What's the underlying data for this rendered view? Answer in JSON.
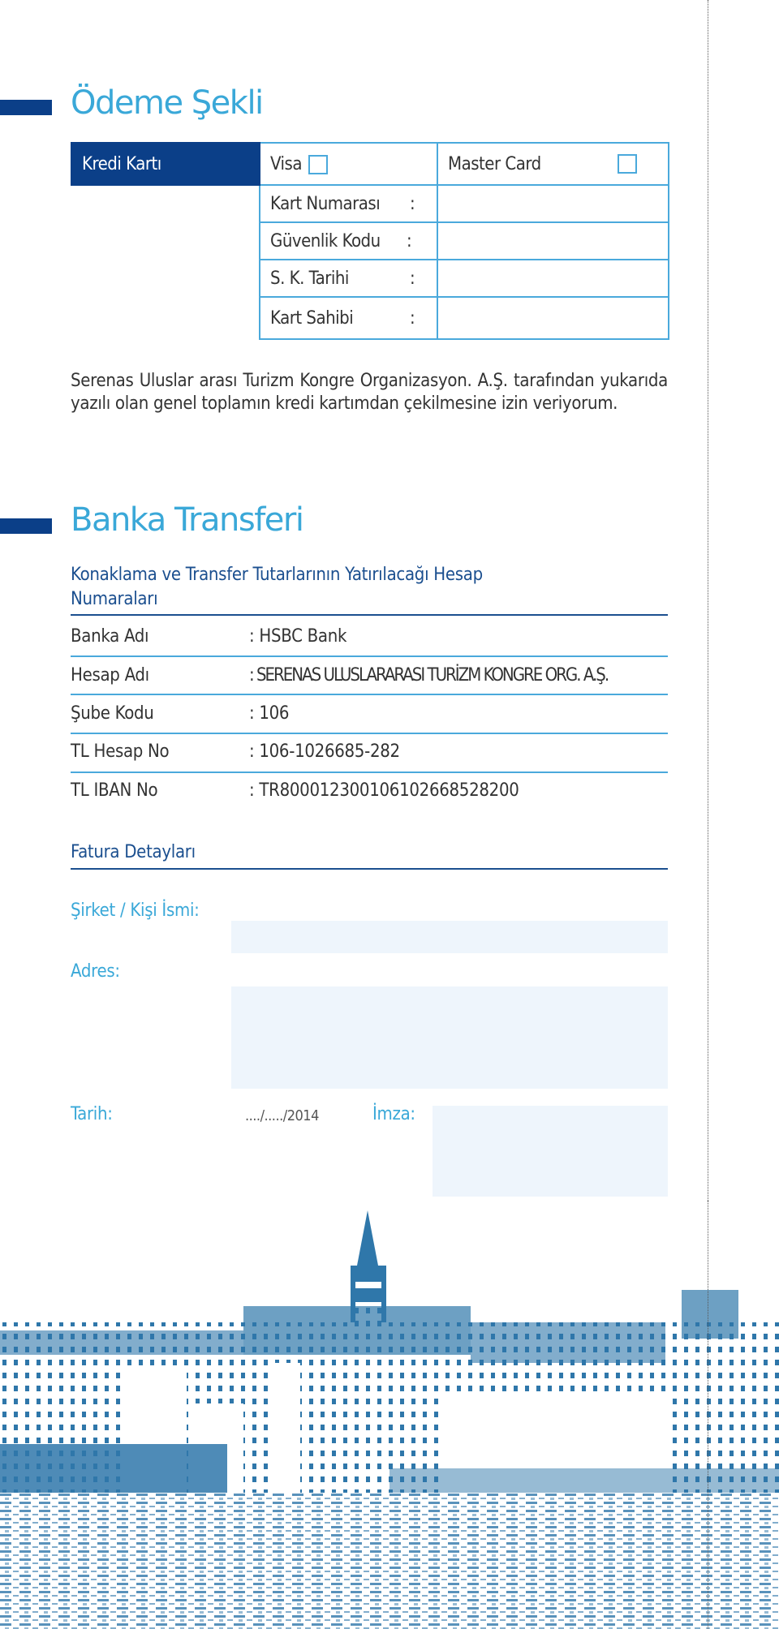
{
  "payment": {
    "title": "Ödeme Şekli",
    "card_header": "Kredi Kartı",
    "visa_label": "Visa",
    "mastercard_label": "Master Card",
    "visa_checked": false,
    "mastercard_checked": false,
    "fields": [
      {
        "label": "Kart Numarası",
        "colon": ":",
        "value": ""
      },
      {
        "label": "Güvenlik Kodu",
        "colon": ":",
        "value": ""
      },
      {
        "label": "S. K. Tarihi",
        "colon": ":",
        "value": ""
      },
      {
        "label": "Kart Sahibi",
        "colon": ":",
        "value": ""
      }
    ],
    "authorization_text": "Serenas Uluslar arası Turizm Kongre Organizasyon. A.Ş. tarafından yukarıda yazılı olan genel toplamın kredi kartımdan çekilmesine izin veriyorum."
  },
  "bank": {
    "title": "Banka Transferi",
    "subtitle": "Konaklama ve Transfer Tutarlarının Yatırılacağı Hesap Numaraları",
    "rows": [
      {
        "label": "Banka Adı",
        "value": ": HSBC Bank"
      },
      {
        "label": "Hesap Adı",
        "value": ": SERENAS ULUSLARARASI TURİZM KONGRE ORG. A.Ş."
      },
      {
        "label": "Şube Kodu",
        "value": ": 106"
      },
      {
        "label": "TL Hesap No",
        "value": ": 106-1026685-282"
      },
      {
        "label": "TL IBAN  No",
        "value": ": TR800012300106102668528200"
      }
    ]
  },
  "invoice": {
    "title": "Fatura Detayları",
    "company_label": "Şirket / Kişi İsmi:",
    "company_value": "",
    "address_label": "Adres:",
    "address_value": "",
    "date_label": "Tarih:",
    "date_value": "..../...../2014",
    "signature_label": "İmza:"
  },
  "colors": {
    "dark_blue": "#0b3f88",
    "title_blue": "#3aa8d8",
    "border_blue": "#4aa9dc",
    "field_fill": "#eef5fc",
    "illustration_blue": "#2f77aa"
  },
  "illustration": {
    "subject": "istanbul-skyline-galata-tower"
  }
}
